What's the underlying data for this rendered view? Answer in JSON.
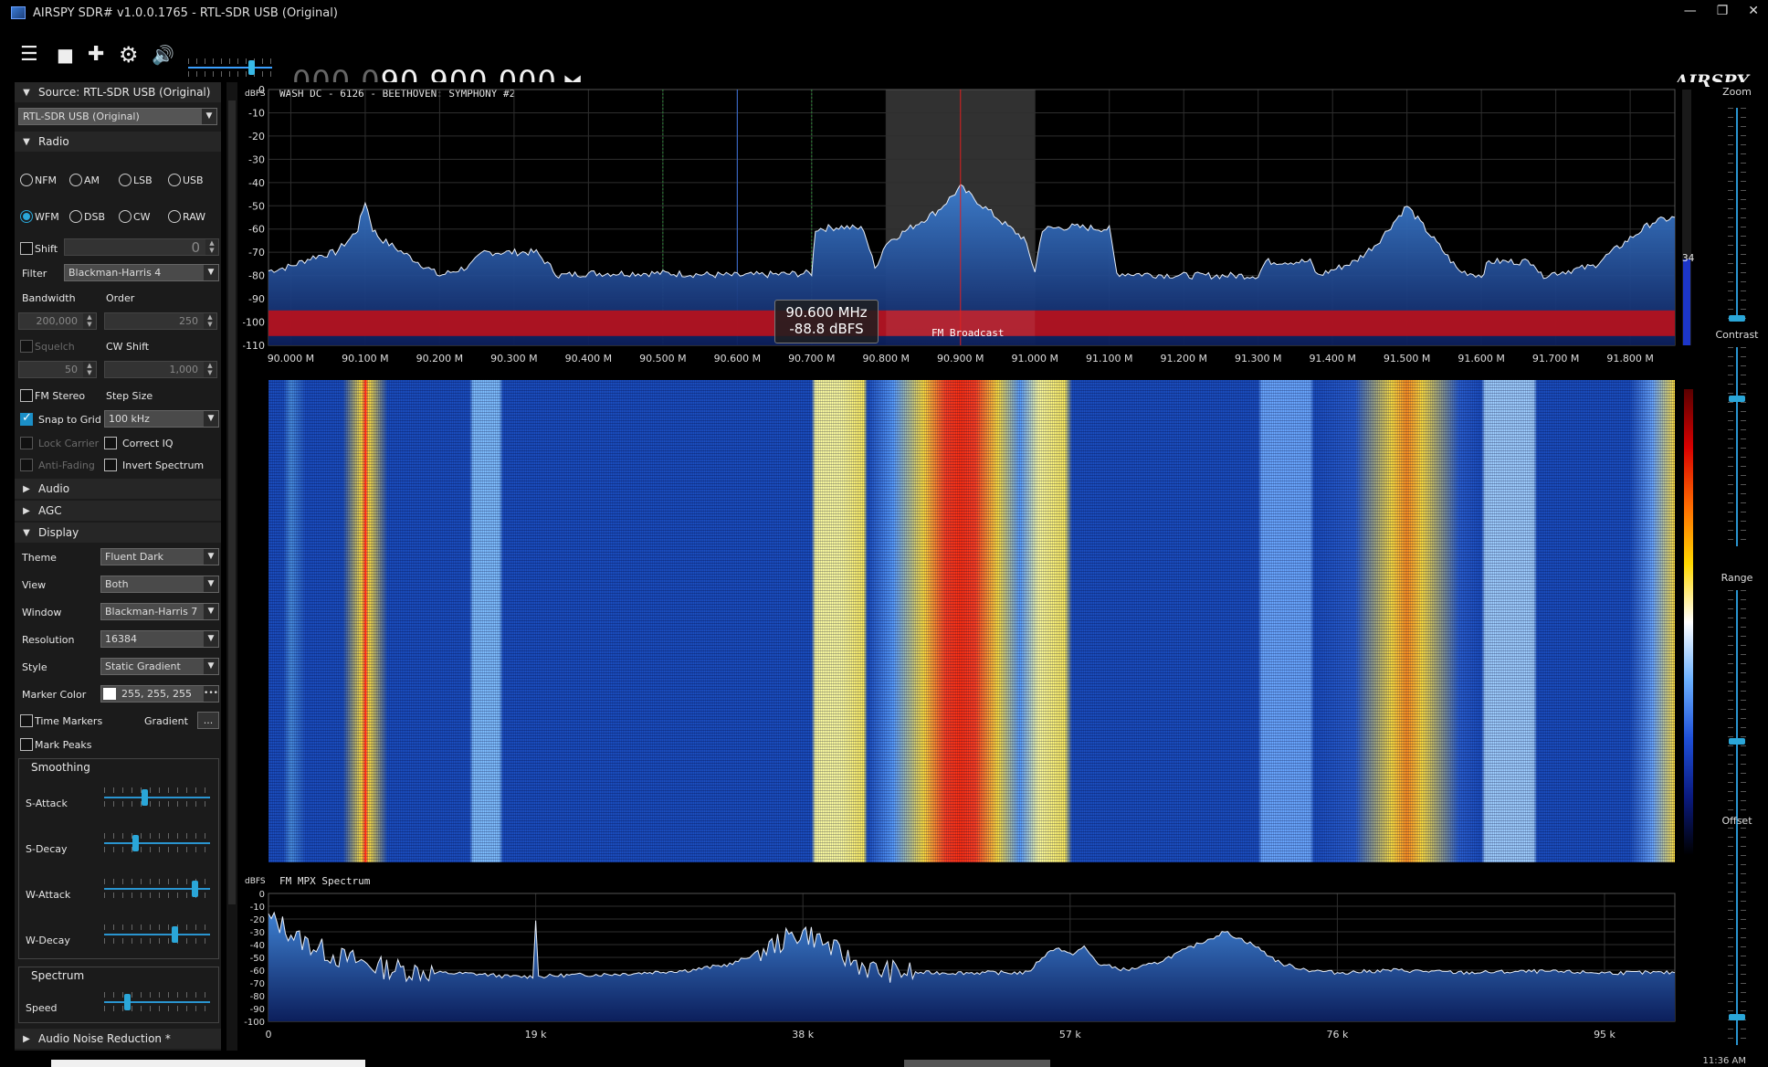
{
  "window": {
    "title": "AIRSPY SDR# v1.0.0.1765 - RTL-SDR USB (Original)",
    "minimize": "—",
    "restore": "❐",
    "close": "✕"
  },
  "toolbar": {
    "menu_icon": "☰",
    "stop_icon": "■",
    "add_icon": "✚",
    "settings_icon": "⚙",
    "speaker_icon": "🔊",
    "volume_level": 0.78,
    "frequency_dim": "000.0",
    "frequency_bright": "90.900.000",
    "swap_icon": "⧓",
    "logo": "AIRSPY"
  },
  "source": {
    "header": "Source: RTL-SDR USB (Original)",
    "device": "RTL-SDR USB (Original)"
  },
  "radio": {
    "header": "Radio",
    "modes": [
      "NFM",
      "AM",
      "LSB",
      "USB",
      "WFM",
      "DSB",
      "CW",
      "RAW"
    ],
    "selected_mode": "WFM",
    "shift_label": "Shift",
    "shift_value": "0",
    "filter_label": "Filter",
    "filter_value": "Blackman-Harris 4",
    "bandwidth_label": "Bandwidth",
    "bandwidth_value": "200,000",
    "order_label": "Order",
    "order_value": "250",
    "squelch_label": "Squelch",
    "squelch_value": "50",
    "cw_shift_label": "CW Shift",
    "cw_shift_value": "1,000",
    "fm_stereo_label": "FM Stereo",
    "step_size_label": "Step Size",
    "snap_to_grid_label": "Snap to Grid",
    "step_size_value": "100 kHz",
    "lock_carrier_label": "Lock Carrier",
    "correct_iq_label": "Correct IQ",
    "anti_fading_label": "Anti-Fading",
    "invert_spectrum_label": "Invert Spectrum"
  },
  "audio": {
    "header": "Audio"
  },
  "agc": {
    "header": "AGC"
  },
  "display": {
    "header": "Display",
    "theme_label": "Theme",
    "theme_value": "Fluent Dark",
    "view_label": "View",
    "view_value": "Both",
    "window_label": "Window",
    "window_value": "Blackman-Harris 7",
    "resolution_label": "Resolution",
    "resolution_value": "16384",
    "style_label": "Style",
    "style_value": "Static Gradient",
    "marker_color_label": "Marker Color",
    "marker_color_value": "255, 255, 255",
    "time_markers_label": "Time Markers",
    "gradient_label": "Gradient",
    "gradient_button": "...",
    "mark_peaks_label": "Mark Peaks",
    "smoothing_title": "Smoothing",
    "s_attack_label": "S-Attack",
    "s_attack_level": 0.38,
    "s_decay_label": "S-Decay",
    "s_decay_level": 0.28,
    "w_attack_label": "W-Attack",
    "w_attack_level": 0.88,
    "w_decay_label": "W-Decay",
    "w_decay_level": 0.68,
    "spectrum_title": "Spectrum",
    "speed_label": "Speed",
    "speed_level": 0.2
  },
  "audio_noise_reduction": {
    "header": "Audio Noise Reduction *"
  },
  "right_panel": {
    "zoom_label": "Zoom",
    "contrast_label": "Contrast",
    "range_label": "Range",
    "offset_label": "Offset",
    "zoom_level": 0.0,
    "contrast_level": 0.75,
    "range_level": 0.5,
    "offset_level": 0.12
  },
  "spectrum": {
    "unit_label": "dBFS",
    "station_text": "WASH DC  - 6126 - BEETHOVEN: SYMPHONY #2",
    "band_label": "FM Broadcast",
    "tooltip_freq": "90.600 MHz",
    "tooltip_level": "-88.8 dBFS",
    "peak_readout": "34",
    "colors": {
      "band": "#b3121f",
      "trace_fill": "#1e5aa8",
      "center_line": "#e02020"
    }
  },
  "mpx": {
    "unit_label": "dBFS",
    "title": "FM MPX Spectrum"
  },
  "status": {
    "clock": "11:36 AM"
  },
  "chart_data": [
    {
      "type": "area",
      "title": "",
      "ylabel": "dBFS",
      "x_unit": "MHz",
      "xlim": [
        89.97,
        91.86
      ],
      "ylim": [
        -110,
        0
      ],
      "y_ticks": [
        0,
        -10,
        -20,
        -30,
        -40,
        -50,
        -60,
        -70,
        -80,
        -90,
        -100,
        -110
      ],
      "x_tick_labels": [
        "90.000 M",
        "90.100 M",
        "90.200 M",
        "90.300 M",
        "90.400 M",
        "90.500 M",
        "90.600 M",
        "90.700 M",
        "90.800 M",
        "90.900 M",
        "91.000 M",
        "91.100 M",
        "91.200 M",
        "91.300 M",
        "91.400 M",
        "91.500 M",
        "91.600 M",
        "91.700 M",
        "91.800 M"
      ],
      "x_tick_values": [
        90.0,
        90.1,
        90.2,
        90.3,
        90.4,
        90.5,
        90.6,
        90.7,
        90.8,
        90.9,
        91.0,
        91.1,
        91.2,
        91.3,
        91.4,
        91.5,
        91.6,
        91.7,
        91.8
      ],
      "grid": true,
      "center_frequency": 90.9,
      "filter_band": [
        90.8,
        91.0
      ],
      "marker_lines": [
        90.5,
        90.6,
        90.7
      ],
      "series": [
        {
          "x": [
            89.97,
            90.0,
            90.03,
            90.06,
            90.08,
            90.09,
            90.1,
            90.11,
            90.12,
            90.14,
            90.16,
            90.2,
            90.24,
            90.26,
            90.29,
            90.33,
            90.36,
            90.4,
            90.5,
            90.6,
            90.7,
            90.705,
            90.74,
            90.77,
            90.785,
            90.8,
            90.84,
            90.87,
            90.9,
            90.93,
            90.96,
            90.985,
            91.0,
            91.01,
            91.05,
            91.1,
            91.11,
            91.2,
            91.3,
            91.31,
            91.37,
            91.38,
            91.43,
            91.46,
            91.5,
            91.54,
            91.57,
            91.6,
            91.61,
            91.67,
            91.68,
            91.75,
            91.8,
            91.83,
            91.86
          ],
          "y": [
            -78,
            -76,
            -72,
            -70,
            -64,
            -60,
            -48,
            -60,
            -64,
            -68,
            -72,
            -80,
            -76,
            -70,
            -70,
            -70,
            -80,
            -79,
            -79,
            -80,
            -79,
            -60,
            -59,
            -60,
            -77,
            -66,
            -58,
            -52,
            -42,
            -50,
            -58,
            -64,
            -78,
            -60,
            -59,
            -60,
            -79,
            -80,
            -80,
            -74,
            -74,
            -80,
            -74,
            -66,
            -50,
            -66,
            -78,
            -80,
            -74,
            -74,
            -80,
            -76,
            -64,
            -57,
            -55
          ]
        }
      ],
      "annotations": [
        "FM Broadcast",
        "90.600 MHz",
        "-88.8 dBFS"
      ]
    },
    {
      "type": "area",
      "title": "FM MPX Spectrum",
      "ylabel": "dBFS",
      "xlim": [
        0,
        100
      ],
      "x_unit": "kHz",
      "ylim": [
        -100,
        0
      ],
      "y_ticks": [
        0,
        -10,
        -20,
        -30,
        -40,
        -50,
        -60,
        -70,
        -80,
        -90,
        -100
      ],
      "x_tick_labels": [
        "0",
        "19 k",
        "38 k",
        "57 k",
        "76 k",
        "95 k"
      ],
      "x_tick_values": [
        0,
        19,
        38,
        57,
        76,
        95
      ],
      "grid": true,
      "series": [
        {
          "x": [
            0,
            1,
            2,
            3,
            4,
            5,
            6,
            7,
            8,
            10,
            12,
            15,
            17,
            18.8,
            19,
            19.2,
            21,
            25,
            30,
            33,
            35,
            37,
            38,
            39,
            41,
            43,
            46,
            50,
            54,
            55,
            56,
            57,
            58,
            59,
            61,
            63,
            65,
            67,
            68,
            70,
            72,
            74,
            76,
            80,
            85,
            90,
            95,
            100
          ],
          "y": [
            -20,
            -25,
            -35,
            -40,
            -45,
            -50,
            -52,
            -55,
            -58,
            -60,
            -62,
            -63,
            -65,
            -65,
            -20,
            -65,
            -64,
            -63,
            -60,
            -55,
            -45,
            -35,
            -30,
            -35,
            -50,
            -60,
            -62,
            -62,
            -62,
            -50,
            -42,
            -48,
            -42,
            -55,
            -60,
            -55,
            -45,
            -35,
            -30,
            -40,
            -55,
            -60,
            -62,
            -60,
            -62,
            -61,
            -62,
            -62
          ]
        }
      ]
    }
  ]
}
